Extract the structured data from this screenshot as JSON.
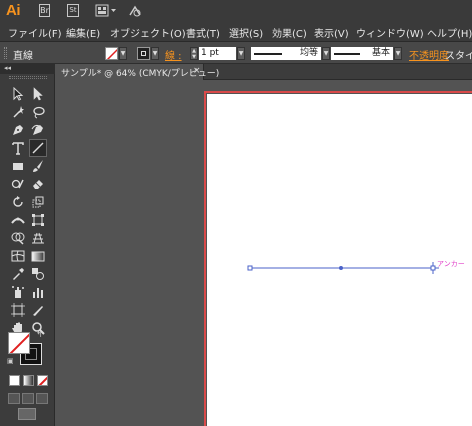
{
  "app": {
    "logo": "Ai"
  },
  "titlebar": {
    "bridge_label": "Br",
    "stock_label": "St"
  },
  "menu": [
    {
      "label": "ファイル(F)"
    },
    {
      "label": "編集(E)"
    },
    {
      "label": "オブジェクト(O)"
    },
    {
      "label": "書式(T)"
    },
    {
      "label": "選択(S)"
    },
    {
      "label": "効果(C)"
    },
    {
      "label": "表示(V)"
    },
    {
      "label": "ウィンドウ(W)"
    },
    {
      "label": "ヘルプ(H)"
    }
  ],
  "control": {
    "selection_label": "直線",
    "stroke_weight_label": "線 :",
    "stroke_weight_value": "1 pt",
    "variable_width_profile": "均等",
    "brush_definition": "基本",
    "opacity_label": "不透明度",
    "style_label": "スタイル"
  },
  "document": {
    "tab_title": "サンプル* @ 64% (CMYK/プレビュー)",
    "close_glyph": "×"
  },
  "canvas": {
    "smart_guide_label": "アンカー"
  },
  "colors": {
    "accent_orange": "#f7931e",
    "artboard_border": "#d94a4a",
    "selection_blue": "#4a62c8",
    "smart_guide_magenta": "#e040c8"
  },
  "tools": [
    {
      "name": "selection-tool",
      "icon": "arrow-icon"
    },
    {
      "name": "direct-selection-tool",
      "icon": "white-arrow-icon"
    },
    {
      "name": "magic-wand-tool",
      "icon": "magic-wand-icon"
    },
    {
      "name": "lasso-tool",
      "icon": "lasso-icon"
    },
    {
      "name": "pen-tool",
      "icon": "pen-icon"
    },
    {
      "name": "curvature-tool",
      "icon": "curvature-icon"
    },
    {
      "name": "type-tool",
      "icon": "type-icon"
    },
    {
      "name": "line-segment-tool",
      "icon": "line-icon",
      "active": true
    },
    {
      "name": "rectangle-tool",
      "icon": "rectangle-icon"
    },
    {
      "name": "paintbrush-tool",
      "icon": "brush-icon"
    }
  ]
}
